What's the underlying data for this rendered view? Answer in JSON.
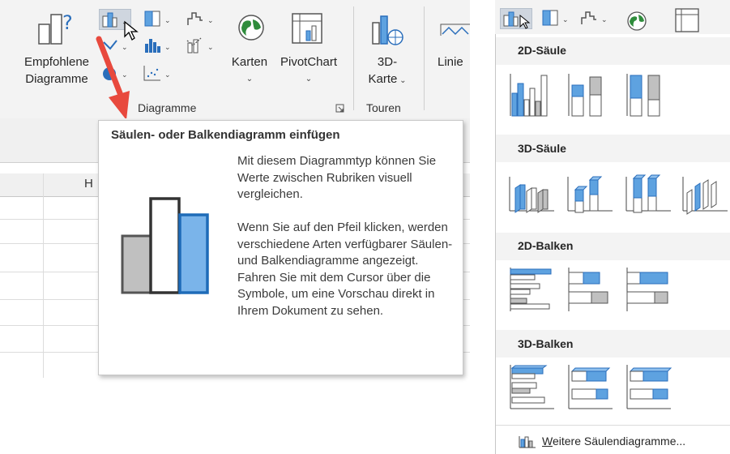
{
  "ribbon": {
    "recommended_label_line1": "Empfohlene",
    "recommended_label_line2": "Diagramme",
    "maps_label": "Karten",
    "pivotchart_label": "PivotChart",
    "threed_label_line1": "3D-",
    "threed_label_line2": "Karte",
    "line_label": "Linie",
    "group_charts": "Diagramme",
    "group_tours": "Touren"
  },
  "sheet": {
    "column_header": "H"
  },
  "tooltip": {
    "title": "Säulen- oder Balkendiagramm einfügen",
    "body": "Mit diesem Diagrammtyp können Sie Werte zwischen Rubriken visuell vergleichen.\n\nWenn Sie auf den Pfeil klicken, werden verschiedene Arten verfügbarer Säulen- und Balkendiagramme angezeigt. Fahren Sie mit dem Cursor über die Symbole, um eine Vorschau direkt in Ihrem Dokument zu sehen."
  },
  "dropdown": {
    "sections": [
      {
        "title": "2D-Säule"
      },
      {
        "title": "3D-Säule"
      },
      {
        "title": "2D-Balken"
      },
      {
        "title": "3D-Balken"
      }
    ],
    "more_link_prefix": "W",
    "more_link_rest": "eitere Säulendiagramme..."
  },
  "colors": {
    "accent_blue": "#5ea2e0",
    "blue_stroke": "#2a6ebb",
    "gray_fill": "#c0c0c0",
    "arrow_red": "#e8493d",
    "ribbon_bg": "#f3f3f3"
  }
}
